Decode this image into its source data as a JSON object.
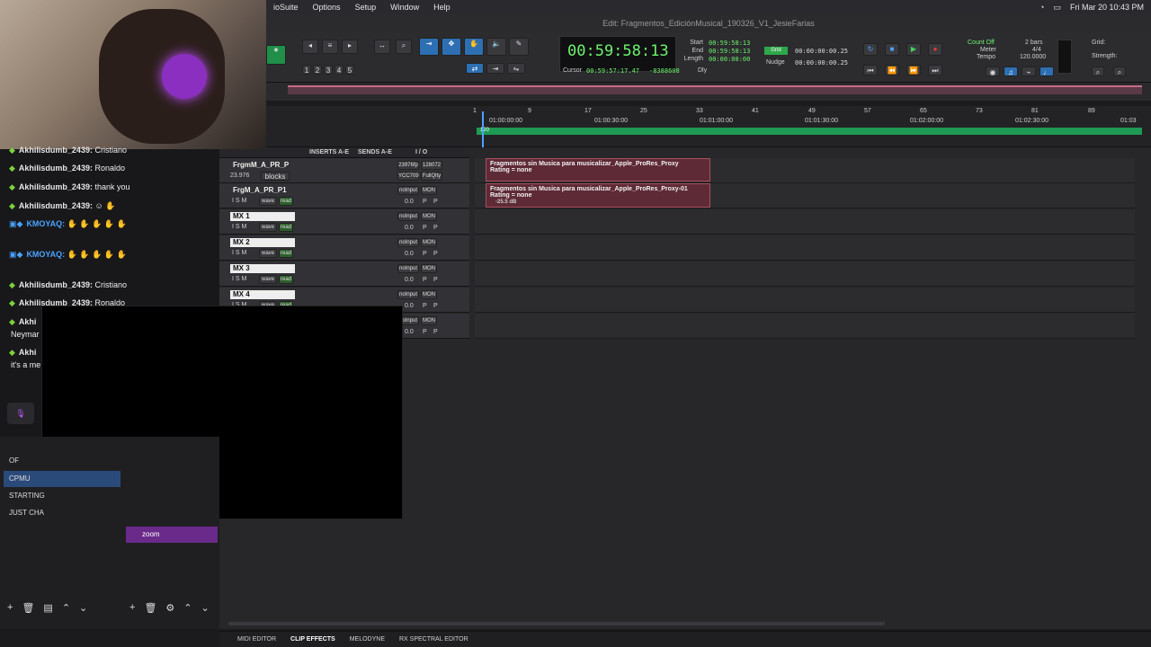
{
  "menubar": {
    "app_partial": "ioSuite",
    "items": [
      "Options",
      "Setup",
      "Window",
      "Help"
    ],
    "clock": "Fri Mar 20  10:43 PM"
  },
  "window": {
    "title": "Edit: Fragmentos_EdiciónMusical_190326_V1_JesieFarias"
  },
  "transport": {
    "main_counter": "00:59:58:13",
    "start_label": "Start",
    "end_label": "End",
    "length_label": "Length",
    "start_val": "00:59:58:13",
    "end_val": "00:59:58:13",
    "length_val": "00:00:00:00",
    "cursor_label": "Cursor",
    "cursor_val": "00:59:57:17.47",
    "sample_val": "-8388608",
    "dly_label": "Dly",
    "grid_label": "Grid",
    "grid_val": "00:00:00:00.25",
    "nudge_label": "Nudge",
    "nudge_val": "00:00:00:00.25",
    "count_off": "Count Off",
    "meter_label": "Meter",
    "tempo_label": "Tempo",
    "bars_val": "2 bars",
    "meter_val": "4/4",
    "tempo_val": "120.0000",
    "grid_right": "Grid:",
    "strength": "Strength:",
    "preset_btn1": "1",
    "preset_btn2": "2",
    "preset_btn3": "3",
    "preset_btn4": "4",
    "preset_btn5": "5"
  },
  "ruler": {
    "bars": [
      "1",
      "9",
      "17",
      "25",
      "33",
      "41",
      "49",
      "57",
      "65",
      "73",
      "81",
      "89"
    ],
    "times": [
      "01:00:00:00",
      "01:00:30:00",
      "01:01:00:00",
      "01:01:30:00",
      "01:02:00:00",
      "01:02:30:00",
      "01:03"
    ],
    "tempo_marker": "120"
  },
  "track_header_cols": {
    "inserts": "INSERTS A-E",
    "sends": "SENDS A-E",
    "io": "I / O"
  },
  "tracks": [
    {
      "name": "FrgmM_A_PR_P",
      "sub": "23.976",
      "btn": "blocks",
      "io1": "23976fp",
      "io2": "128072",
      "io3": "YCC709",
      "io4": "FullQlty"
    },
    {
      "name": "FrgM_A_PR_P1",
      "io1": "noInput",
      "io2": "MON",
      "vol": "0.0",
      "p1": "P",
      "p2": "P"
    },
    {
      "name": "MX 1",
      "io1": "noInput",
      "io2": "MON",
      "vol": "0.0",
      "p1": "P",
      "p2": "P"
    },
    {
      "name": "MX 2",
      "io1": "noInput",
      "io2": "MON",
      "vol": "0.0",
      "p1": "P",
      "p2": "P"
    },
    {
      "name": "MX 3",
      "io1": "noInput",
      "io2": "MON",
      "vol": "0.0",
      "p1": "P",
      "p2": "P"
    },
    {
      "name": "MX 4",
      "io1": "noInput",
      "io2": "MON",
      "vol": "0.0",
      "p1": "P",
      "p2": "P"
    },
    {
      "name": "",
      "io1": "noInput",
      "io2": "MON",
      "vol": "0.0",
      "p1": "P",
      "p2": "P"
    }
  ],
  "track_buttons": {
    "i": "I",
    "s": "S",
    "m": "M",
    "wave": "wave",
    "read": "read"
  },
  "clips": [
    {
      "line1": "Fragmentos sin Musica para musicalizar_Apple_ProRes_Proxy",
      "line2": "Rating = none"
    },
    {
      "line1": "Fragmentos sin Musica para musicalizar_Apple_ProRes_Proxy-01",
      "line2": "Rating = none",
      "line3": "-25.5 dB"
    }
  ],
  "chat": {
    "lines": [
      {
        "user": "Akhilisdumb_2439:",
        "msg": "Cristiano"
      },
      {
        "user": "Akhilisdumb_2439:",
        "msg": "Ronaldo"
      },
      {
        "user": "Akhilisdumb_2439:",
        "msg": "thank you"
      },
      {
        "user": "Akhilisdumb_2439:",
        "msg": ""
      },
      {
        "user": "KMOYAQ:",
        "msg": ""
      },
      {
        "user": "KMOYAQ:",
        "msg": ""
      },
      {
        "user": "Akhilisdumb_2439:",
        "msg": "Cristiano"
      },
      {
        "user": "Akhilisdumb_2439:",
        "msg": "Ronaldo"
      },
      {
        "user": "Akhi",
        "msg": ""
      },
      {
        "user": "",
        "msg": "Neymar"
      },
      {
        "user": "Akhi",
        "msg": ""
      },
      {
        "user": "",
        "msg": "it's a me"
      }
    ]
  },
  "obs": {
    "scenes": [
      "OF",
      "CPMU",
      "STARTING",
      "JUST CHA"
    ],
    "source": "zoom"
  },
  "bottom_tabs": [
    "MIDI EDITOR",
    "CLIP EFFECTS",
    "MELODYNE",
    "RX SPECTRAL EDITOR"
  ],
  "colors": {
    "accent_green": "#6df36d",
    "clip": "#5e2a36",
    "twitch_purple": "#7b2fa8"
  }
}
